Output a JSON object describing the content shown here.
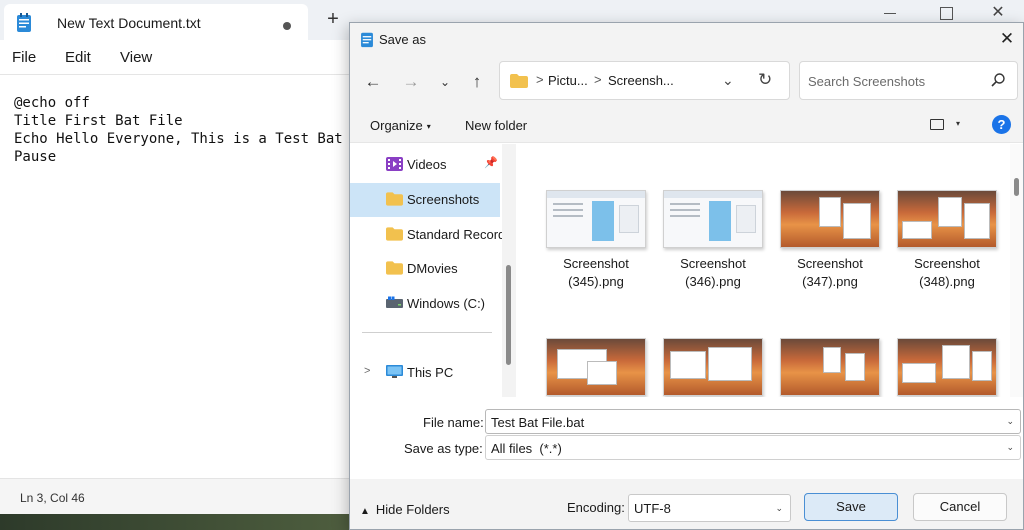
{
  "notepad": {
    "tab_title": "New Text Document.txt",
    "new_tab": "+",
    "close_glyph": "✕",
    "menu": [
      "File",
      "Edit",
      "View"
    ],
    "lines": [
      "@echo off",
      "Title First Bat File",
      "Echo Hello Everyone, This is a Test Bat",
      "Pause"
    ],
    "status_position": "Ln 3, Col 46"
  },
  "dialog": {
    "title": "Save as",
    "close_glyph": "✕",
    "nav": {
      "back": "←",
      "forward": "→",
      "recent": "⌄",
      "up": "↑"
    },
    "address": {
      "crumbs": [
        "Pictu...",
        "Screensh..."
      ],
      "separator": ">",
      "dropdown": "⌄",
      "refresh": "↻"
    },
    "search": {
      "placeholder": "Search Screenshots"
    },
    "toolbar": {
      "organize": "Organize",
      "organize_caret": "▾",
      "new_folder": "New folder",
      "view_caret": "▾",
      "help": "?"
    },
    "nav_pane": {
      "items": [
        {
          "label": "Videos",
          "icon": "videos-icon",
          "pinned": true
        },
        {
          "label": "Screenshots",
          "icon": "folder-icon",
          "selected": true
        },
        {
          "label": "Standard Record",
          "icon": "folder-icon"
        },
        {
          "label": "DMovies",
          "icon": "folder-icon"
        },
        {
          "label": "Windows (C:)",
          "icon": "drive-icon"
        },
        {
          "label": "This PC",
          "icon": "computer-icon",
          "expander": ">"
        }
      ],
      "pin_glyph": "📌"
    },
    "files": [
      {
        "name": "Screenshot\n(345).png",
        "thumb": "spreadsheet"
      },
      {
        "name": "Screenshot\n(346).png",
        "thumb": "spreadsheet"
      },
      {
        "name": "Screenshot\n(347).png",
        "thumb": "desert"
      },
      {
        "name": "Screenshot\n(348).png",
        "thumb": "desert"
      },
      {
        "name": "",
        "thumb": "desert"
      },
      {
        "name": "",
        "thumb": "desert"
      },
      {
        "name": "",
        "thumb": "desert"
      },
      {
        "name": "",
        "thumb": "desert"
      }
    ],
    "file_name": {
      "label": "File name:",
      "value": "Test Bat File.bat",
      "caret": "⌄"
    },
    "save_type": {
      "label": "Save as type:",
      "value": "All files  (*.*)",
      "caret": "⌄"
    },
    "footer": {
      "hide_folders": "Hide Folders",
      "hide_caret": "▲",
      "encoding_label": "Encoding:",
      "encoding_value": "UTF-8",
      "encoding_caret": "⌄",
      "save": "Save",
      "cancel": "Cancel"
    }
  },
  "colors": {
    "accent": "#1a73e8",
    "selection": "#cce4f7",
    "folder": "#f2c14e",
    "save_button_border": "#4a8fd4"
  }
}
